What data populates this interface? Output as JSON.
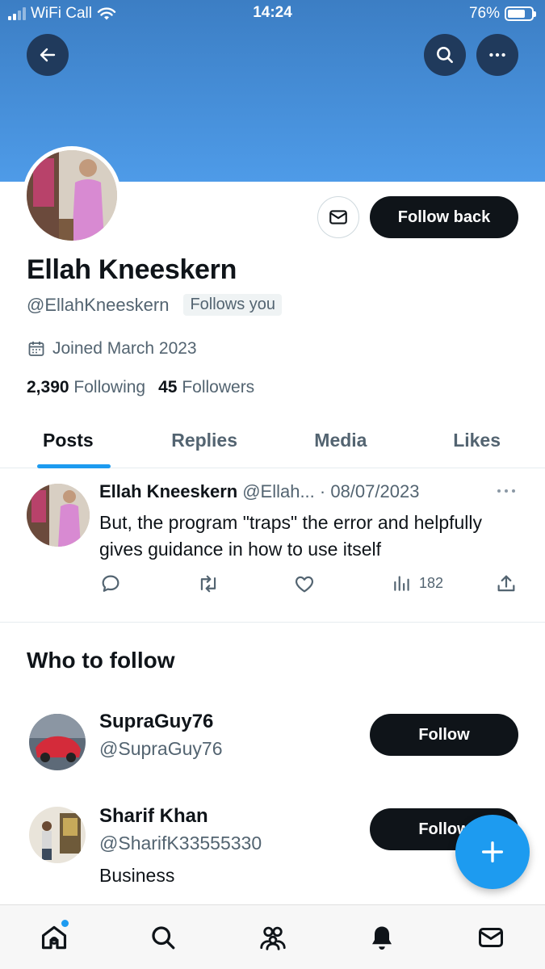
{
  "status_bar": {
    "carrier": "WiFi Call",
    "time": "14:24",
    "battery": "76%",
    "battery_level": 0.76
  },
  "profile": {
    "name": "Ellah Kneeskern",
    "handle": "@EllahKneeskern",
    "follows_you": "Follows you",
    "joined": "Joined March 2023",
    "following_count": "2,390",
    "following_label": "Following",
    "followers_count": "45",
    "followers_label": "Followers",
    "follow_back_label": "Follow back"
  },
  "tabs": [
    {
      "label": "Posts",
      "active": true
    },
    {
      "label": "Replies",
      "active": false
    },
    {
      "label": "Media",
      "active": false
    },
    {
      "label": "Likes",
      "active": false
    }
  ],
  "tweet": {
    "name": "Ellah Kneeskern",
    "meta": "@Ellah... · 08/07/2023",
    "text": "But, the program \"traps\" the error and helpfully gives guidance in how to use itself",
    "views": "182"
  },
  "who_to_follow": {
    "title": "Who to follow",
    "users": [
      {
        "name": "SupraGuy76",
        "handle": "@SupraGuy76",
        "bio": "",
        "button": "Follow"
      },
      {
        "name": "Sharif Khan",
        "handle": "@SharifK33555330",
        "bio": "Business",
        "button": "Follow"
      }
    ]
  },
  "colors": {
    "accent": "#1d9bf0",
    "banner": "#4e9be8",
    "dark": "#0f1419",
    "muted": "#536471"
  },
  "icons": [
    "back-arrow-icon",
    "search-icon",
    "more-icon",
    "envelope-icon",
    "calendar-icon",
    "reply-icon",
    "retweet-icon",
    "like-icon",
    "views-icon",
    "share-icon",
    "compose-plus-icon",
    "home-icon",
    "explore-icon",
    "communities-icon",
    "notifications-icon",
    "messages-icon"
  ]
}
